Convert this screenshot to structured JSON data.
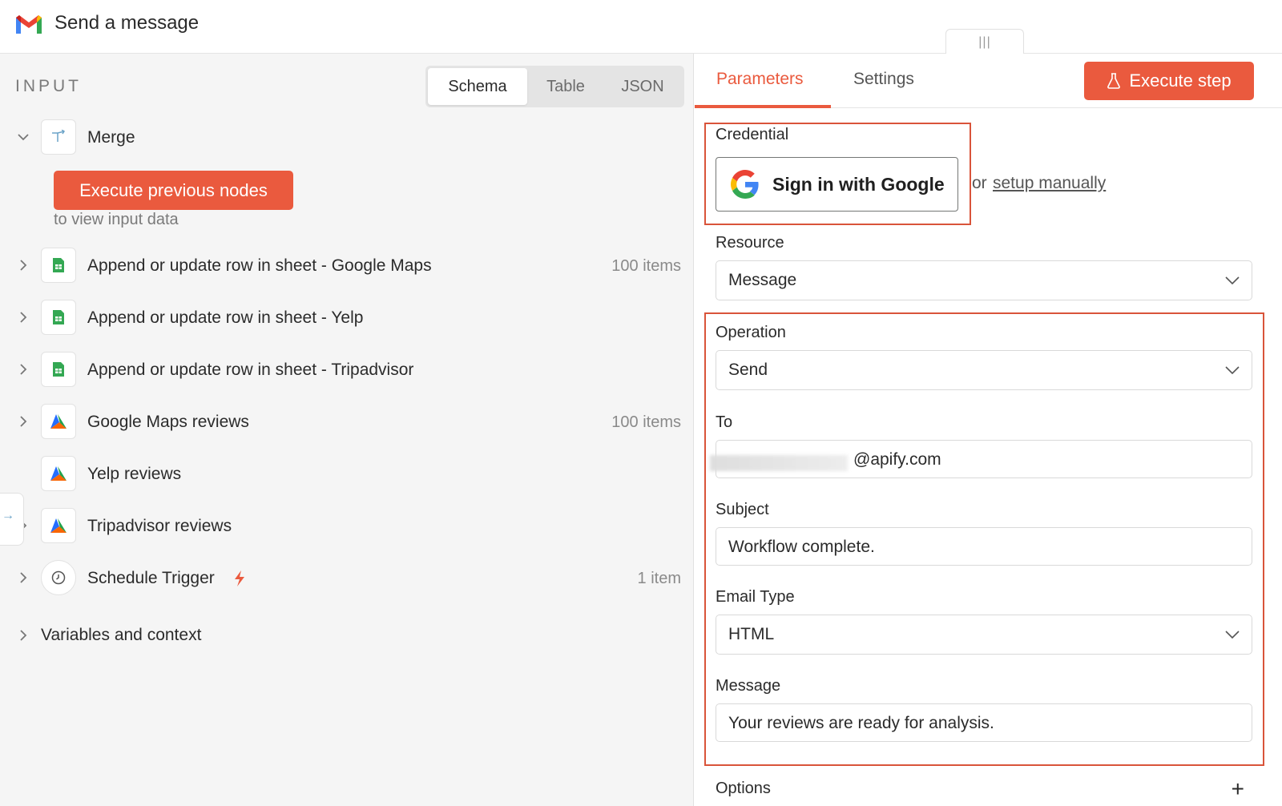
{
  "header": {
    "title": "Send a message",
    "drag_handle": "|||"
  },
  "input_panel": {
    "title": "INPUT",
    "view_options": [
      "Schema",
      "Table",
      "JSON"
    ],
    "selected_view": "Schema",
    "merge": {
      "label": "Merge",
      "execute_button": "Execute previous nodes",
      "hint": "to view input data"
    },
    "nodes": [
      {
        "label": "Append or update row in sheet - Google Maps",
        "icon": "sheets-icon",
        "count": "100 items"
      },
      {
        "label": "Append or update row in sheet - Yelp",
        "icon": "sheets-icon",
        "count": ""
      },
      {
        "label": "Append or update row in sheet - Tripadvisor",
        "icon": "sheets-icon",
        "count": ""
      },
      {
        "label": "Google Maps reviews",
        "icon": "apify-icon",
        "count": "100 items"
      },
      {
        "label": "Yelp reviews",
        "icon": "apify-icon",
        "count": ""
      },
      {
        "label": "Tripadvisor reviews",
        "icon": "apify-icon",
        "count": ""
      },
      {
        "label": "Schedule Trigger",
        "icon": "clock-icon",
        "count": "1 item"
      }
    ],
    "variables_label": "Variables and context"
  },
  "params_panel": {
    "tabs": [
      "Parameters",
      "Settings"
    ],
    "active_tab": "Parameters",
    "execute_step": "Execute step",
    "credential": {
      "label": "Credential",
      "google_button": "Sign in with Google",
      "or": "or",
      "setup_link": "setup manually"
    },
    "resource": {
      "label": "Resource",
      "value": "Message"
    },
    "operation": {
      "label": "Operation",
      "value": "Send"
    },
    "to": {
      "label": "To",
      "value": "@apify.com"
    },
    "subject": {
      "label": "Subject",
      "value": "Workflow complete."
    },
    "email_type": {
      "label": "Email Type",
      "value": "HTML"
    },
    "message": {
      "label": "Message",
      "value": "Your reviews are ready for analysis."
    },
    "options": {
      "label": "Options",
      "add": "+"
    }
  },
  "colors": {
    "accent": "#ea5a3e",
    "highlight_border": "#d9543a",
    "sheets_green": "#34a853",
    "panel_bg": "#f5f5f5"
  }
}
